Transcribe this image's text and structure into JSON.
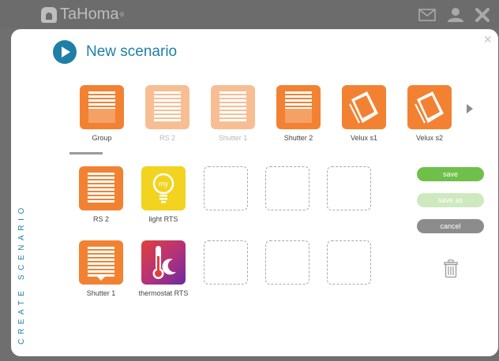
{
  "app": {
    "logo_text": "TaHoma",
    "logo_mark": "®"
  },
  "topbar_icons": [
    "mail-icon",
    "user-icon",
    "close-icon"
  ],
  "modal": {
    "title": "New scenario",
    "side_label": "CREATE SCENARIO",
    "close_glyph": "×"
  },
  "device_strip": [
    {
      "label": "Group",
      "icon": "roller-shutter-icon",
      "faded": false
    },
    {
      "label": "RS 2",
      "icon": "roller-shutter-icon",
      "faded": true
    },
    {
      "label": "Shutter 1",
      "icon": "roller-shutter-icon",
      "faded": true
    },
    {
      "label": "Shutter 2",
      "icon": "roller-shutter-icon",
      "faded": false
    },
    {
      "label": "Velux s1",
      "icon": "velux-window-icon",
      "faded": false
    },
    {
      "label": "Velux s2",
      "icon": "velux-window-icon",
      "faded": false
    }
  ],
  "scenario_rows": [
    {
      "devices": [
        {
          "label": "RS 2",
          "icon": "roller-shutter-icon"
        },
        {
          "label": "light RTS",
          "icon": "light-bulb-icon",
          "badge": "my"
        }
      ]
    },
    {
      "devices": [
        {
          "label": "Shutter 1",
          "icon": "roller-shutter-icon"
        },
        {
          "label": "thermostat RTS",
          "icon": "thermostat-icon"
        }
      ]
    }
  ],
  "buttons": {
    "save": "save",
    "save_as": "save as",
    "cancel": "cancel"
  },
  "colors": {
    "accent": "#1f7fa6",
    "device_orange": "#f28232",
    "save_green": "#6fc04a",
    "cancel_gray": "#8c8c8c"
  }
}
